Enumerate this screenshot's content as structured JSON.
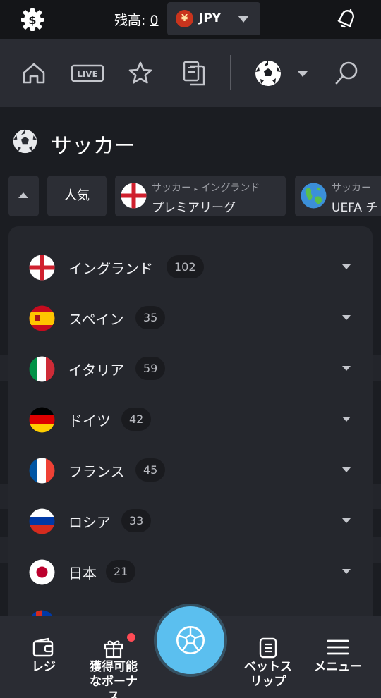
{
  "topbar": {
    "balance_label": "残高:",
    "balance_value": "0",
    "currency_symbol": "¥",
    "currency_code": "JPY"
  },
  "nav": {
    "live_label": "LIVE",
    "icons": [
      "home-icon",
      "live-icon",
      "star-icon",
      "betslip-history-icon",
      "soccer-ball-icon",
      "search-icon"
    ]
  },
  "page": {
    "title": "サッカー"
  },
  "chips": {
    "popular_label": "人気",
    "leagues": [
      {
        "crumb_sport": "サッカー",
        "crumb_region": "イングランド",
        "name": "プレミアリーグ"
      },
      {
        "crumb_sport": "サッカー",
        "crumb_region": "",
        "name": "UEFA チ"
      }
    ]
  },
  "countries": [
    {
      "name": "イングランド",
      "count": "102"
    },
    {
      "name": "スペイン",
      "count": "35"
    },
    {
      "name": "イタリア",
      "count": "59"
    },
    {
      "name": "ドイツ",
      "count": "42"
    },
    {
      "name": "フランス",
      "count": "45"
    },
    {
      "name": "ロシア",
      "count": "33"
    },
    {
      "name": "日本",
      "count": "21"
    }
  ],
  "bottom_nav": {
    "cashier_label": "レジ",
    "bonus_label_1": "獲得可能",
    "bonus_label_2": "なボーナ",
    "bonus_label_3": "ス",
    "betslip_label_1": "ベットス",
    "betslip_label_2": "リップ",
    "menu_label": "メニュー"
  },
  "colors": {
    "background": "#1b1d22",
    "panel": "#25272d",
    "accent": "#5bbfef",
    "notification": "#ff4b55"
  }
}
